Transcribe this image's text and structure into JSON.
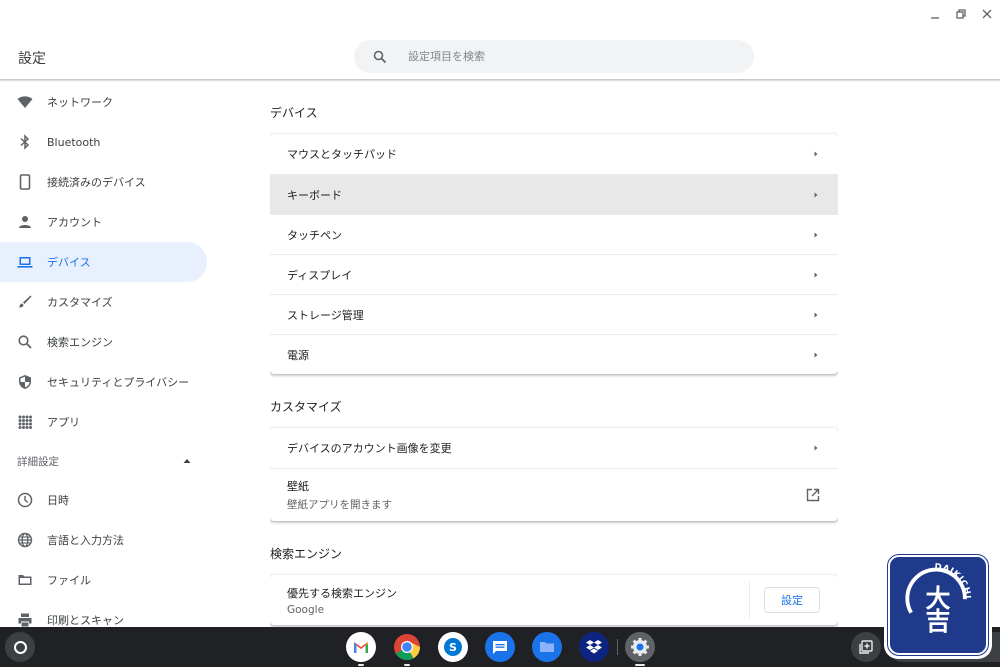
{
  "window": {
    "controls": [
      "minimize",
      "restore",
      "close"
    ]
  },
  "header": {
    "title": "設定",
    "search": {
      "placeholder": "設定項目を検索",
      "value": ""
    }
  },
  "sidebar": {
    "items": [
      {
        "label": "ネットワーク",
        "icon": "wifi-icon",
        "active": false
      },
      {
        "label": "Bluetooth",
        "icon": "bluetooth-icon",
        "active": false
      },
      {
        "label": "接続済みのデバイス",
        "icon": "phone-icon",
        "active": false
      },
      {
        "label": "アカウント",
        "icon": "person-icon",
        "active": false
      },
      {
        "label": "デバイス",
        "icon": "laptop-icon",
        "active": true
      },
      {
        "label": "カスタマイズ",
        "icon": "brush-icon",
        "active": false
      },
      {
        "label": "検索エンジン",
        "icon": "search-icon",
        "active": false
      },
      {
        "label": "セキュリティとプライバシー",
        "icon": "shield-icon",
        "active": false
      },
      {
        "label": "アプリ",
        "icon": "apps-grid-icon",
        "active": false
      }
    ],
    "advanced": {
      "label": "詳細設定",
      "expanded": true,
      "items": [
        {
          "label": "日時",
          "icon": "clock-icon"
        },
        {
          "label": "言語と入力方法",
          "icon": "globe-icon"
        },
        {
          "label": "ファイル",
          "icon": "folder-icon"
        },
        {
          "label": "印刷とスキャン",
          "icon": "printer-icon"
        }
      ]
    }
  },
  "main": {
    "sections": [
      {
        "title": "デバイス",
        "rows": [
          {
            "label": "マウスとタッチパッド"
          },
          {
            "label": "キーボード",
            "hovered": true
          },
          {
            "label": "タッチペン"
          },
          {
            "label": "ディスプレイ"
          },
          {
            "label": "ストレージ管理"
          },
          {
            "label": "電源"
          }
        ]
      },
      {
        "title": "カスタマイズ",
        "rows": [
          {
            "label": "デバイスのアカウント画像を変更"
          },
          {
            "label": "壁紙",
            "sublabel": "壁紙アプリを開きます",
            "action": "external-link"
          }
        ]
      },
      {
        "title": "検索エンジン",
        "rows": [
          {
            "label": "優先する検索エンジン",
            "sublabel": "Google",
            "button": "設定"
          }
        ]
      }
    ]
  },
  "shelf": {
    "apps": [
      {
        "name": "Gmail",
        "running": true
      },
      {
        "name": "Chrome",
        "running": true
      },
      {
        "name": "Skype",
        "running": false
      },
      {
        "name": "Messages",
        "running": false
      },
      {
        "name": "Files",
        "running": false
      },
      {
        "name": "Dropbox",
        "running": false
      },
      {
        "name": "Settings",
        "running": true,
        "active": true
      }
    ]
  },
  "watermark": {
    "text": "DAIKICHI",
    "glyph": "大吉"
  }
}
